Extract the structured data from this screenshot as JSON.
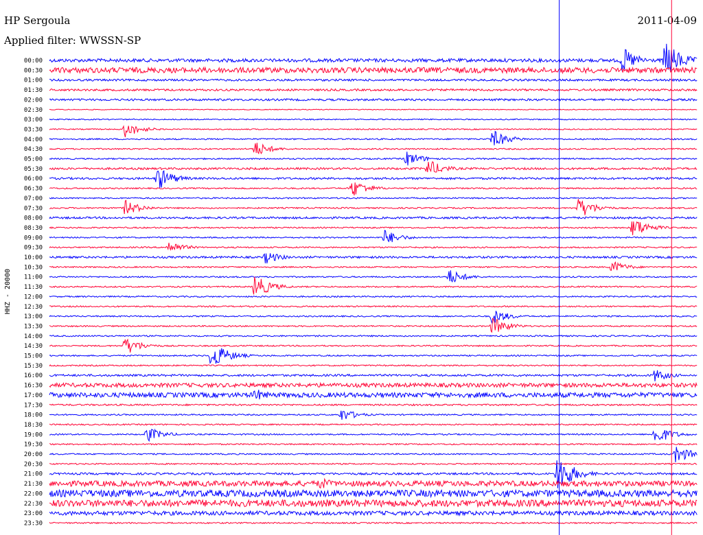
{
  "header": {
    "station": "HP Sergoula",
    "filter_label": "Applied filter: WWSSN-SP",
    "date": "2011-04-09"
  },
  "chart_data": {
    "type": "line",
    "title": "HP Sergoula",
    "subtitle": "Applied filter: WWSSN-SP",
    "date": "2011-04-09",
    "ylabel": "HHZ - 20000",
    "xlabel": "",
    "row_labels": [
      "00:00",
      "00:30",
      "01:00",
      "01:30",
      "02:00",
      "02:30",
      "03:00",
      "03:30",
      "04:00",
      "04:30",
      "05:00",
      "05:30",
      "06:00",
      "06:30",
      "07:00",
      "07:30",
      "08:00",
      "08:30",
      "09:00",
      "09:30",
      "10:00",
      "10:30",
      "11:00",
      "11:30",
      "12:00",
      "12:30",
      "13:00",
      "13:30",
      "14:00",
      "14:30",
      "15:00",
      "15:30",
      "16:00",
      "16:30",
      "17:00",
      "17:30",
      "18:00",
      "18:30",
      "19:00",
      "19:30",
      "20:00",
      "20:30",
      "21:00",
      "21:30",
      "22:00",
      "22:30",
      "23:00",
      "23:30"
    ],
    "minutes_per_row": 30,
    "series_colors": [
      "#0000ff",
      "#ff0033"
    ],
    "background_amplitude": [
      2.5,
      4,
      1.5,
      1.5,
      1.5,
      0.6,
      0.8,
      0.8,
      1,
      1,
      1,
      1.5,
      1.5,
      1,
      1,
      1,
      1.5,
      1,
      1,
      1,
      1.5,
      1,
      1,
      1,
      1,
      1,
      1,
      1,
      1,
      1,
      1,
      1,
      1.5,
      3,
      3.5,
      1.2,
      1,
      1,
      1,
      1,
      1,
      1,
      1.5,
      4,
      5,
      5,
      3,
      1
    ],
    "events": [
      {
        "row": 0,
        "minute": 26.5,
        "amplitude": 20
      },
      {
        "row": 0,
        "minute": 28.5,
        "amplitude": 30
      },
      {
        "row": 7,
        "minute": 3.5,
        "amplitude": 12
      },
      {
        "row": 8,
        "minute": 20.5,
        "amplitude": 14
      },
      {
        "row": 9,
        "minute": 9.5,
        "amplitude": 12
      },
      {
        "row": 10,
        "minute": 16.5,
        "amplitude": 12
      },
      {
        "row": 11,
        "minute": 17.5,
        "amplitude": 14
      },
      {
        "row": 12,
        "minute": 5,
        "amplitude": 18
      },
      {
        "row": 13,
        "minute": 14,
        "amplitude": 14
      },
      {
        "row": 15,
        "minute": 3.5,
        "amplitude": 12
      },
      {
        "row": 15,
        "minute": 24.5,
        "amplitude": 16
      },
      {
        "row": 17,
        "minute": 27,
        "amplitude": 16
      },
      {
        "row": 18,
        "minute": 15.5,
        "amplitude": 12
      },
      {
        "row": 19,
        "minute": 5.5,
        "amplitude": 10
      },
      {
        "row": 20,
        "minute": 10,
        "amplitude": 10
      },
      {
        "row": 21,
        "minute": 26,
        "amplitude": 10
      },
      {
        "row": 22,
        "minute": 18.5,
        "amplitude": 12
      },
      {
        "row": 23,
        "minute": 9.5,
        "amplitude": 18
      },
      {
        "row": 26,
        "minute": 20.5,
        "amplitude": 12
      },
      {
        "row": 27,
        "minute": 20.5,
        "amplitude": 14
      },
      {
        "row": 29,
        "minute": 3.5,
        "amplitude": 14
      },
      {
        "row": 30,
        "minute": 7.5,
        "amplitude": 22
      },
      {
        "row": 32,
        "minute": 28,
        "amplitude": 10
      },
      {
        "row": 34,
        "minute": 9.5,
        "amplitude": 10
      },
      {
        "row": 36,
        "minute": 13.5,
        "amplitude": 10
      },
      {
        "row": 38,
        "minute": 4.5,
        "amplitude": 12
      },
      {
        "row": 38,
        "minute": 28,
        "amplitude": 16
      },
      {
        "row": 40,
        "minute": 29,
        "amplitude": 14
      },
      {
        "row": 42,
        "minute": 23.5,
        "amplitude": 30
      },
      {
        "row": 43,
        "minute": 12.5,
        "amplitude": 10
      }
    ],
    "cursor_lines": [
      {
        "minute": 23.6,
        "color": "#0000ff"
      },
      {
        "minute": 28.8,
        "color": "#ff0033"
      }
    ]
  }
}
